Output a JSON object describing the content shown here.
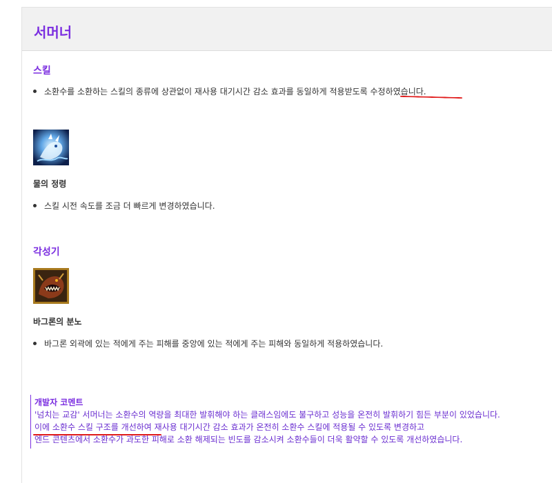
{
  "header": {
    "title": "서머너"
  },
  "sections": {
    "skill": {
      "title": "스킬",
      "bullet": "소환수를 소환하는 스킬의 종류에 상관없이 재사용 대기시간 감소 효과를 동일하게 적용받도록 수정하였습니다."
    },
    "water_spirit": {
      "icon": "water-spirit-skill-icon",
      "name": "물의 정령",
      "bullet": "스킬 시전 속도를 조금 더 빠르게 변경하였습니다."
    },
    "awakening": {
      "title": "각성기",
      "icon": "bagron-fury-skill-icon",
      "name": "바그론의 분노",
      "bullet": "바그론 외곽에 있는 적에게 주는 피해를 중앙에 있는 적에게 주는 피해와 동일하게 적용하였습니다."
    }
  },
  "dev_comment": {
    "title": "개발자 코멘트",
    "lines": [
      "'넘치는 교감' 서머너는 소환수의 역량을 최대한 발휘해야 하는 클래스임에도 불구하고 성능을 온전히 발휘하기 힘든 부분이 있었습니다.",
      "이에 소환수 스킬 구조를 개선하여 재사용 대기시간 감소 효과가 온전히 소환수 스킬에 적용될 수 있도록 변경하고",
      "엔드 콘텐츠에서 소환수가 과도한 피해로 소환 해제되는 빈도를 감소시켜 소환수들이 더욱 활약할 수 있도록 개선하였습니다."
    ]
  },
  "colors": {
    "accent": "#7b2ee0",
    "annotation": "#e01818",
    "comment_text": "#6a2ed0"
  }
}
